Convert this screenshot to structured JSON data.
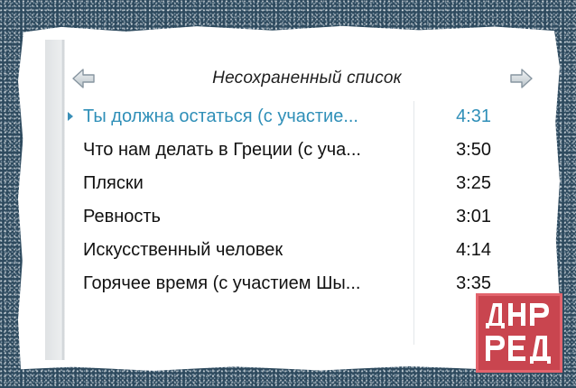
{
  "header": {
    "title": "Несохраненный список",
    "back_icon": "arrow-left-icon",
    "forward_icon": "arrow-right-icon"
  },
  "playlist": {
    "now_playing_icon": "play-triangle-icon",
    "tracks": [
      {
        "title": "Ты должна остаться (с участие...",
        "duration": "4:31",
        "playing": true
      },
      {
        "title": "Что нам делать в Греции (с уча...",
        "duration": "3:50",
        "playing": false
      },
      {
        "title": "Пляски",
        "duration": "3:25",
        "playing": false
      },
      {
        "title": "Ревность",
        "duration": "3:01",
        "playing": false
      },
      {
        "title": "Искусственный человек",
        "duration": "4:14",
        "playing": false
      },
      {
        "title": "Горячее время (с участием Шы...",
        "duration": "3:35",
        "playing": false
      }
    ]
  },
  "watermark": {
    "text": "ДНР РЕД"
  },
  "colors": {
    "accent": "#2f8fb8",
    "text": "#111111",
    "watermark": "#c9454f"
  }
}
